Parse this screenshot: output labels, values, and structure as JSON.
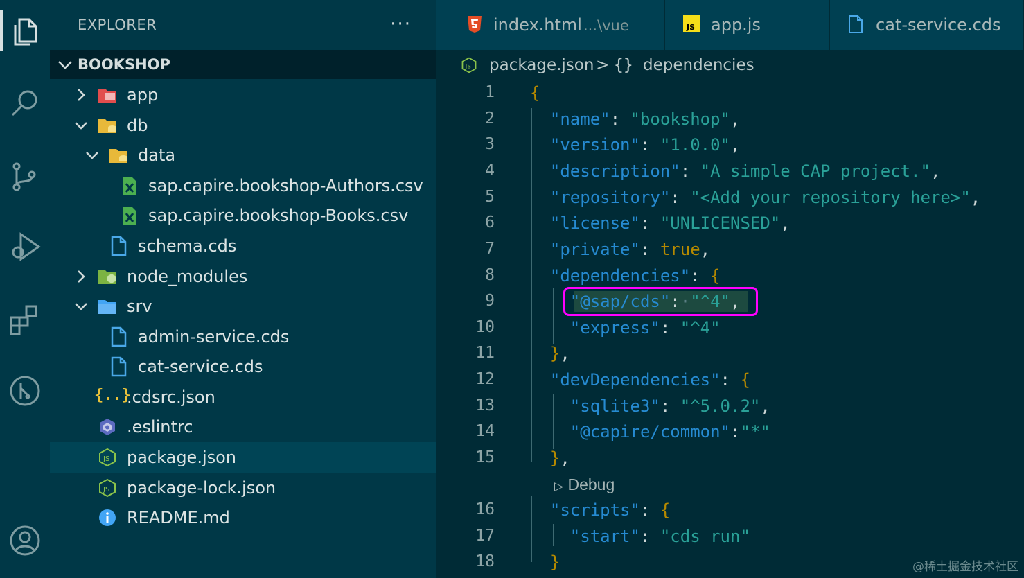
{
  "sidebar": {
    "title": "EXPLORER",
    "more": "···",
    "project": "BOOKSHOP",
    "tree": [
      {
        "label": "app"
      },
      {
        "label": "db"
      },
      {
        "label": "data"
      },
      {
        "label": "sap.capire.bookshop-Authors.csv"
      },
      {
        "label": "sap.capire.bookshop-Books.csv"
      },
      {
        "label": "schema.cds"
      },
      {
        "label": "node_modules"
      },
      {
        "label": "srv"
      },
      {
        "label": "admin-service.cds"
      },
      {
        "label": "cat-service.cds"
      },
      {
        "label": ".cdsrc.json"
      },
      {
        "label": ".eslintrc"
      },
      {
        "label": "package.json"
      },
      {
        "label": "package-lock.json"
      },
      {
        "label": "README.md"
      }
    ]
  },
  "tabs": [
    {
      "label": "index.html",
      "detail": "...\\vue"
    },
    {
      "label": "app.js"
    },
    {
      "label": "cat-service.cds"
    }
  ],
  "breadcrumb": {
    "file": "package.json",
    "separator": ">",
    "node_icon": "{}",
    "node": "dependencies"
  },
  "editor": {
    "line_numbers": [
      "1",
      "2",
      "3",
      "4",
      "5",
      "6",
      "7",
      "8",
      "9",
      "10",
      "11",
      "12",
      "13",
      "14",
      "15",
      "16",
      "17",
      "18"
    ],
    "codelens": "Debug",
    "highlighted_line": 9
  },
  "watermark": "@稀土掘金技术社区",
  "colors": {
    "accent": "#268bd2",
    "string": "#2aa198",
    "bracket": "#b58900",
    "highlight": "#ff00ff",
    "background": "#002b36"
  }
}
